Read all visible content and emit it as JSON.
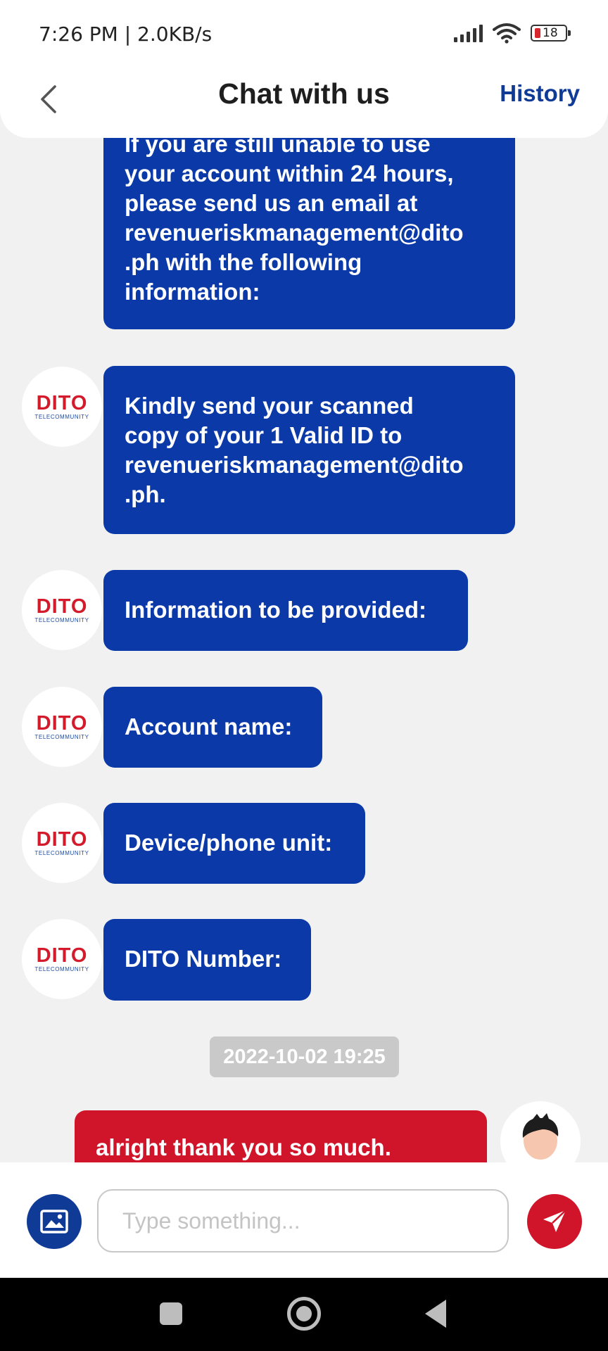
{
  "status_bar": {
    "time_speed": "7:26 PM | 2.0KB/s",
    "battery": "18"
  },
  "header": {
    "title": "Chat with us",
    "history_label": "History"
  },
  "messages": [
    {
      "sender": "agent",
      "avatar_logo": "DITO",
      "avatar_sub": "TELECOMMUNITY",
      "lines": [
        "If you are still unable to use",
        "your account within 24 hours,",
        "please send us an email at",
        "revenueriskmanagement@dito",
        ".ph with the following",
        "information:"
      ]
    },
    {
      "sender": "agent",
      "avatar_logo": "DITO",
      "avatar_sub": "TELECOMMUNITY",
      "lines": [
        "Kindly send your scanned",
        "copy of your 1 Valid ID to",
        "revenueriskmanagement@dito",
        ".ph."
      ]
    },
    {
      "sender": "agent",
      "avatar_logo": "DITO",
      "avatar_sub": "TELECOMMUNITY",
      "lines": [
        "Information to be provided:"
      ]
    },
    {
      "sender": "agent",
      "avatar_logo": "DITO",
      "avatar_sub": "TELECOMMUNITY",
      "lines": [
        "Account name:"
      ]
    },
    {
      "sender": "agent",
      "avatar_logo": "DITO",
      "avatar_sub": "TELECOMMUNITY",
      "lines": [
        "Device/phone unit:"
      ]
    },
    {
      "sender": "agent",
      "avatar_logo": "DITO",
      "avatar_sub": "TELECOMMUNITY",
      "lines": [
        "DITO Number:"
      ]
    },
    {
      "sender": "user",
      "lines": [
        "alright thank you so much."
      ]
    }
  ],
  "timestamp": "2022-10-02 19:25",
  "composer": {
    "placeholder": "Type something...",
    "value": ""
  },
  "colors": {
    "agent_bubble": "#0b39a8",
    "user_bubble": "#d0142a",
    "accent_blue": "#0f3a96",
    "chat_background": "#f1f1f2"
  },
  "icons": [
    "back-chevron-icon",
    "image-icon",
    "send-icon",
    "wifi-icon",
    "signal-icon",
    "battery-icon"
  ]
}
